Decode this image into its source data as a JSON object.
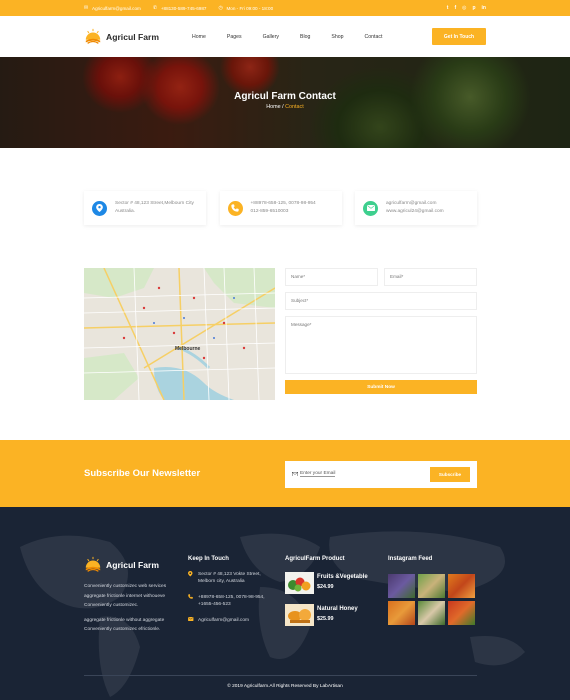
{
  "topbar": {
    "email": "Agriculfarm@gmail.com",
    "phone": "+88130-589-745-6987",
    "hours": "Mon - Fri 09:00 - 18:00",
    "social_icons": [
      "twitter-icon",
      "facebook-icon",
      "instagram-icon",
      "pinterest-icon",
      "linkedin-icon"
    ]
  },
  "header": {
    "brand": "Agricul Farm",
    "nav": [
      "Home",
      "Pages",
      "Gallery",
      "Blog",
      "Shop",
      "Contact"
    ],
    "cta": "Get In Touch"
  },
  "hero": {
    "title": "Agricul Farm Contact",
    "crumb_home": "Home",
    "crumb_sep": " / ",
    "crumb_current": "Contact"
  },
  "cards": [
    {
      "icon": "location-pin-icon",
      "color": "#1e88e5",
      "line1": "Sector # 48,123 Street,Melbourn City",
      "line2": "Australia."
    },
    {
      "icon": "phone-icon",
      "color": "#fbb324",
      "line1": "+88978-658-125, 0078-98-954",
      "line2": "012-859-6510003"
    },
    {
      "icon": "mail-icon",
      "color": "#3ecf8e",
      "line1": "agriculfarm@gmail.com",
      "line2": "www.agricul24@gmail.com"
    }
  ],
  "map": {
    "label": "Melbourne"
  },
  "form": {
    "name": "Name*",
    "email": "Email*",
    "subject": "Subject*",
    "message": "Message*",
    "submit": "Submit Now"
  },
  "newsletter": {
    "title": "Subscribe Our Newsletter",
    "placeholder": "Enter your Email",
    "button": "Subscribe"
  },
  "footer": {
    "brand": "Agricul Farm",
    "about": [
      "Conveniently customizec web services aggregate frictionle internet withoueve Conveniently customizec.",
      "aggregate frictionle without aggregate Conveniently customizec efrictionle."
    ],
    "keep_title": "Keep In Touch",
    "keep": [
      {
        "icon": "location-pin-icon",
        "text": "Sector # 48,123 Vokte Street, Melborn city, Australia"
      },
      {
        "icon": "phone-icon",
        "text": "+88978-658-125, 0078-98-954, +1655-456-523"
      },
      {
        "icon": "mail-icon",
        "text": "Agriculfarm@gmail.com"
      }
    ],
    "products_title": "AgriculFarm Product",
    "products": [
      {
        "name": "Fruits &Vegetable",
        "price": "$24.99"
      },
      {
        "name": "Natural Honey",
        "price": "$25.99"
      }
    ],
    "insta_title": "Instagram Feed",
    "copyright": "© 2019 Agriculfarm.All Rights Reserved By LabArtisan"
  }
}
